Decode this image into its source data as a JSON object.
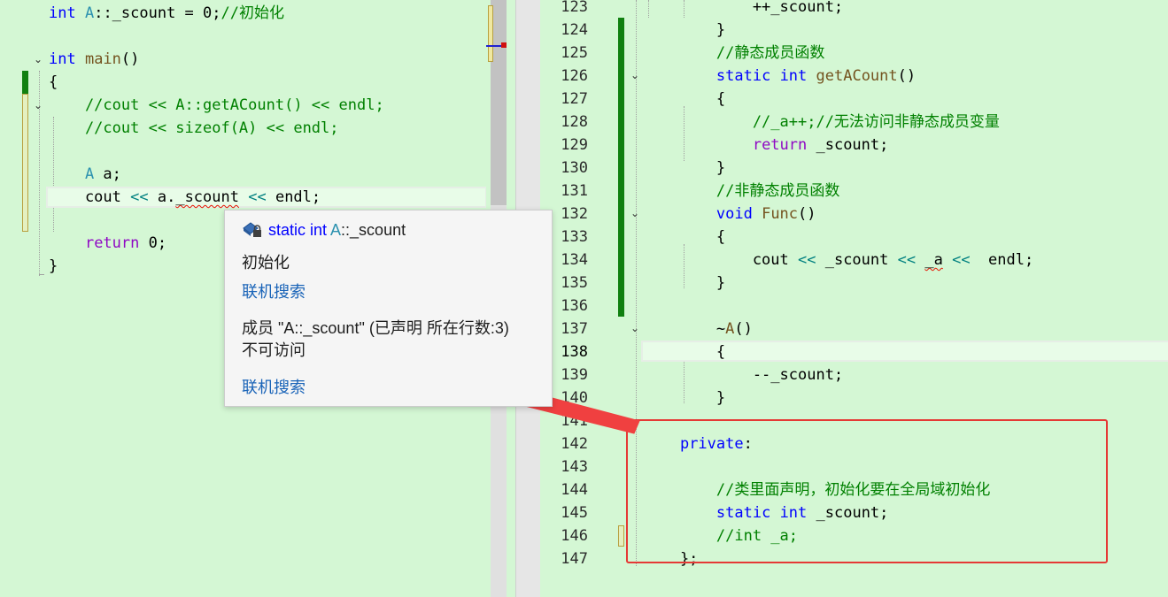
{
  "left_editor": {
    "lines": [
      {
        "id": "l-init",
        "segments": [
          {
            "t": "int",
            "c": "kw"
          },
          {
            "t": " A",
            "c": "cls"
          },
          {
            "t": "::_scount = 0;",
            "c": "id"
          },
          {
            "t": "//初始化",
            "c": "cm"
          }
        ]
      },
      {
        "id": "l-blank1",
        "segments": []
      },
      {
        "id": "l-main",
        "segments": [
          {
            "t": "int",
            "c": "kw"
          },
          {
            "t": " main",
            "c": "fn"
          },
          {
            "t": "()",
            "c": "id"
          }
        ]
      },
      {
        "id": "l-open",
        "segments": [
          {
            "t": "{",
            "c": "id"
          }
        ]
      },
      {
        "id": "l-c1",
        "segments": [
          {
            "t": "    //cout << A::getACount() << endl;",
            "c": "cm"
          }
        ]
      },
      {
        "id": "l-c2",
        "segments": [
          {
            "t": "    //cout << sizeof(A) << endl;",
            "c": "cm"
          }
        ]
      },
      {
        "id": "l-blank2",
        "segments": []
      },
      {
        "id": "l-decl",
        "segments": [
          {
            "t": "    A",
            "c": "cls"
          },
          {
            "t": " a;",
            "c": "id"
          }
        ]
      },
      {
        "id": "l-cout",
        "segments": [
          {
            "t": "    cout ",
            "c": "id"
          },
          {
            "t": "<<",
            "c": "op"
          },
          {
            "t": " a.",
            "c": "id"
          },
          {
            "t": "_scount",
            "c": "id squig"
          },
          {
            "t": " ",
            "c": "id"
          },
          {
            "t": "<<",
            "c": "op"
          },
          {
            "t": " endl;",
            "c": "id"
          }
        ]
      },
      {
        "id": "l-blank3",
        "segments": []
      },
      {
        "id": "l-ret",
        "segments": [
          {
            "t": "    ",
            "c": "id"
          },
          {
            "t": "return",
            "c": "kc"
          },
          {
            "t": " 0;",
            "c": "id"
          }
        ]
      },
      {
        "id": "l-close",
        "segments": [
          {
            "t": "}",
            "c": "id"
          }
        ]
      }
    ]
  },
  "right_editor": {
    "lines": [
      {
        "n": "123",
        "segments": [
          {
            "t": "            ++_scount;",
            "c": "id"
          }
        ]
      },
      {
        "n": "124",
        "segments": [
          {
            "t": "        }",
            "c": "id"
          }
        ]
      },
      {
        "n": "125",
        "segments": [
          {
            "t": "        //静态成员函数",
            "c": "cm"
          }
        ]
      },
      {
        "n": "126",
        "segments": [
          {
            "t": "        ",
            "c": "id"
          },
          {
            "t": "static",
            "c": "kw"
          },
          {
            "t": " ",
            "c": "id"
          },
          {
            "t": "int",
            "c": "kw"
          },
          {
            "t": " getACount",
            "c": "fn"
          },
          {
            "t": "()",
            "c": "id"
          }
        ]
      },
      {
        "n": "127",
        "segments": [
          {
            "t": "        {",
            "c": "id"
          }
        ]
      },
      {
        "n": "128",
        "segments": [
          {
            "t": "            //_a++;//无法访问非静态成员变量",
            "c": "cm"
          }
        ]
      },
      {
        "n": "129",
        "segments": [
          {
            "t": "            ",
            "c": "id"
          },
          {
            "t": "return",
            "c": "kc"
          },
          {
            "t": " _scount;",
            "c": "id"
          }
        ]
      },
      {
        "n": "130",
        "segments": [
          {
            "t": "        }",
            "c": "id"
          }
        ]
      },
      {
        "n": "131",
        "segments": [
          {
            "t": "        //非静态成员函数",
            "c": "cm"
          }
        ]
      },
      {
        "n": "132",
        "segments": [
          {
            "t": "        ",
            "c": "id"
          },
          {
            "t": "void",
            "c": "kw"
          },
          {
            "t": " Func",
            "c": "fn"
          },
          {
            "t": "()",
            "c": "id"
          }
        ]
      },
      {
        "n": "133",
        "segments": [
          {
            "t": "        {",
            "c": "id"
          }
        ]
      },
      {
        "n": "134",
        "segments": [
          {
            "t": "            cout ",
            "c": "id"
          },
          {
            "t": "<<",
            "c": "op"
          },
          {
            "t": " _scount ",
            "c": "id"
          },
          {
            "t": "<<",
            "c": "op"
          },
          {
            "t": " ",
            "c": "id"
          },
          {
            "t": "_a",
            "c": "id squig"
          },
          {
            "t": " ",
            "c": "id"
          },
          {
            "t": "<<",
            "c": "op"
          },
          {
            "t": "  endl;",
            "c": "id"
          }
        ]
      },
      {
        "n": "135",
        "segments": [
          {
            "t": "        }",
            "c": "id"
          }
        ]
      },
      {
        "n": "136",
        "segments": []
      },
      {
        "n": "137",
        "segments": [
          {
            "t": "        ~",
            "c": "id"
          },
          {
            "t": "A",
            "c": "fn"
          },
          {
            "t": "()",
            "c": "id"
          }
        ]
      },
      {
        "n": "138",
        "segments": [
          {
            "t": "        {",
            "c": "id"
          }
        ]
      },
      {
        "n": "139",
        "segments": [
          {
            "t": "            --_scount;",
            "c": "id"
          }
        ]
      },
      {
        "n": "140",
        "segments": [
          {
            "t": "        }",
            "c": "id"
          }
        ]
      },
      {
        "n": "141",
        "segments": []
      },
      {
        "n": "142",
        "segments": [
          {
            "t": "    ",
            "c": "id"
          },
          {
            "t": "private",
            "c": "kw"
          },
          {
            "t": ":",
            "c": "id"
          }
        ]
      },
      {
        "n": "143",
        "segments": []
      },
      {
        "n": "144",
        "segments": [
          {
            "t": "        //类里面声明，初始化要在全局域初始化",
            "c": "cm"
          }
        ]
      },
      {
        "n": "145",
        "segments": [
          {
            "t": "        ",
            "c": "id"
          },
          {
            "t": "static",
            "c": "kw"
          },
          {
            "t": " ",
            "c": "id"
          },
          {
            "t": "int",
            "c": "kw"
          },
          {
            "t": " _scount;",
            "c": "id"
          }
        ]
      },
      {
        "n": "146",
        "segments": [
          {
            "t": "        //int _a;",
            "c": "cm"
          }
        ]
      },
      {
        "n": "147",
        "segments": [
          {
            "t": "    };",
            "c": "id"
          }
        ]
      }
    ]
  },
  "tooltip": {
    "signature_prefix": "static int ",
    "signature_class": "A",
    "signature_suffix": "::_scount",
    "comment": "初始化",
    "search_link_1": "联机搜索",
    "error_line1": "成员 \"A::_scount\" (已声明 所在行数:3)",
    "error_line2": "不可访问",
    "search_link_2": "联机搜索",
    "icon": "field-locked-icon"
  },
  "colors": {
    "editor_bg": "#d4f7d4",
    "change_bar": "#108010",
    "highlight_box": "#e53935",
    "arrow": "#f04040"
  }
}
